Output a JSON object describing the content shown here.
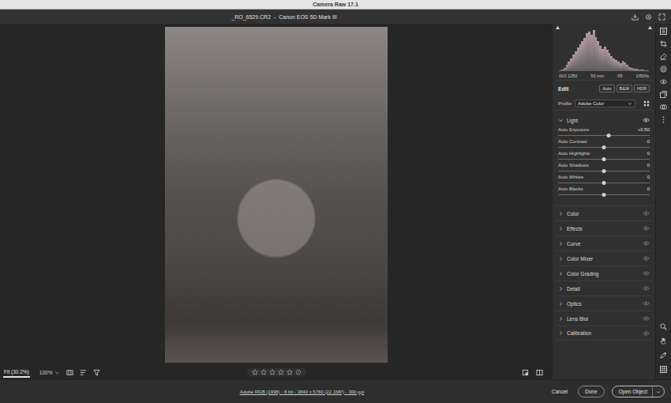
{
  "window": {
    "title": "Camera Raw 17.1"
  },
  "header": {
    "file": "_RO_6529.CR2  -  Canon EOS 5D Mark III"
  },
  "histogram": {
    "values": [
      2,
      4,
      8,
      14,
      22,
      30,
      38,
      46,
      55,
      62,
      70,
      78,
      88,
      92,
      85,
      96,
      80,
      70,
      60,
      52,
      58,
      50,
      42,
      36,
      30,
      26,
      22,
      18,
      24,
      20,
      14,
      10,
      8,
      6,
      5,
      4,
      3,
      3,
      2,
      2
    ],
    "info": [
      "ISO 1250",
      "50 mm",
      "f/5",
      "1/500s"
    ]
  },
  "edit": {
    "title": "Edit",
    "buttons": [
      "Auto",
      "B&W",
      "HDR"
    ]
  },
  "profile": {
    "label": "Profile",
    "value": "Adobe Color"
  },
  "light": {
    "title": "Light",
    "expanded": true,
    "sliders": [
      {
        "label": "Auto Exposure",
        "value": "+0.50",
        "level": 0.55
      },
      {
        "label": "Auto Contrast",
        "value": "0",
        "level": 0.5
      },
      {
        "label": "Auto Highlights",
        "value": "0",
        "level": 0.5
      },
      {
        "label": "Auto Shadows",
        "value": "0",
        "level": 0.5
      },
      {
        "label": "Auto Whites",
        "value": "0",
        "level": 0.5
      },
      {
        "label": "Auto Blacks",
        "value": "0",
        "level": 0.5
      }
    ]
  },
  "sections": [
    {
      "title": "Color",
      "expanded": false
    },
    {
      "title": "Effects",
      "expanded": false
    },
    {
      "title": "Curve",
      "expanded": false
    },
    {
      "title": "Color Mixer",
      "expanded": false
    },
    {
      "title": "Color Grading",
      "expanded": false
    },
    {
      "title": "Detail",
      "expanded": false
    },
    {
      "title": "Optics",
      "expanded": false
    },
    {
      "title": "Lens Blur",
      "expanded": false
    },
    {
      "title": "Calibration",
      "expanded": false
    }
  ],
  "canvas_toolbar": {
    "zoom": "Fit (30.2%)",
    "zoom_100": "100%",
    "stars": 0
  },
  "image_info": "Adobe RGB (1998) - 8 bit - 3840 x 5760 (22.1MP) - 300 ppi",
  "buttons": [
    {
      "label": "Cancel",
      "kind": "text"
    },
    {
      "label": "Done",
      "kind": "outline"
    },
    {
      "label": "Open Object",
      "kind": "split"
    }
  ]
}
